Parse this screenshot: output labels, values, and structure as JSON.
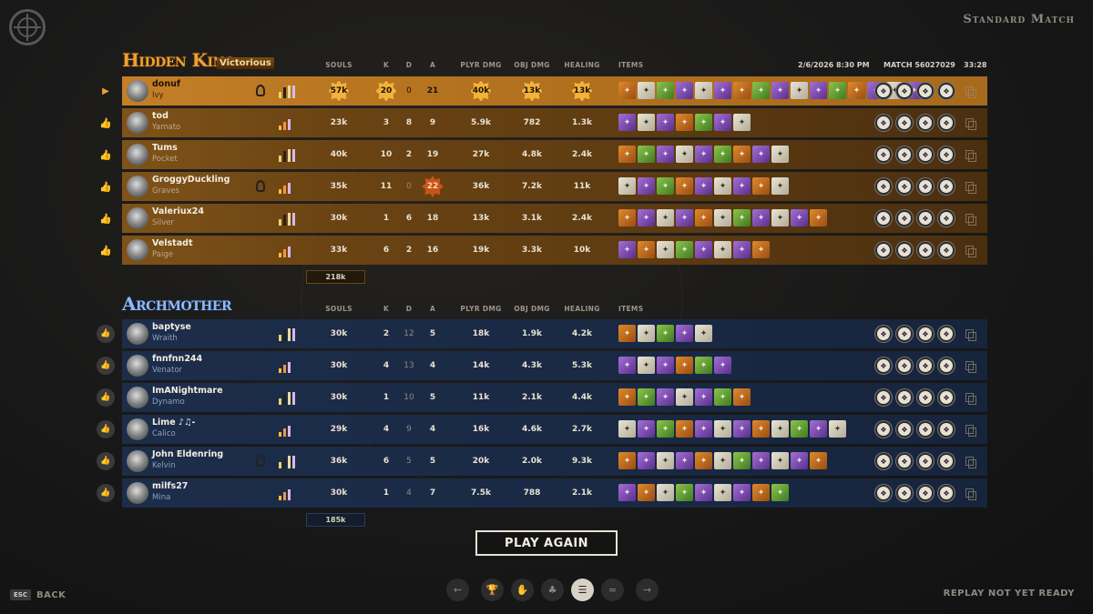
{
  "page": {
    "mode_title": "Standard Match",
    "match_date": "2/6/2026 8:30 PM",
    "match_id": "MATCH 56027029",
    "duration": "33:28",
    "play_again": "PLAY AGAIN",
    "esc_key": "ESC",
    "back_label": "BACK",
    "replay_status": "REPLAY NOT YET READY"
  },
  "columns": {
    "souls": "SOULS",
    "k": "K",
    "d": "D",
    "a": "A",
    "plyr_dmg": "PLYR DMG",
    "obj_dmg": "OBJ DMG",
    "healing": "HEALING",
    "items": "ITEMS"
  },
  "colors": {
    "amber": "#f0a030",
    "blue": "#8fb8f5",
    "badge": "#f2b33d"
  },
  "team1": {
    "name": "Hidden King",
    "result": "Victorious",
    "total_souls": "218k",
    "players": [
      {
        "name": "donuf",
        "hero": "Ivy",
        "souls": "57k",
        "k": "20",
        "d": "0",
        "a": "21",
        "pdmg": "40k",
        "odmg": "13k",
        "heal": "13k",
        "rank": true
      },
      {
        "name": "tod",
        "hero": "Yamato",
        "souls": "23k",
        "k": "3",
        "d": "8",
        "a": "9",
        "pdmg": "5.9k",
        "odmg": "782",
        "heal": "1.3k"
      },
      {
        "name": "Tums",
        "hero": "Pocket",
        "souls": "40k",
        "k": "10",
        "d": "2",
        "a": "19",
        "pdmg": "27k",
        "odmg": "4.8k",
        "heal": "2.4k"
      },
      {
        "name": "GroggyDuckling",
        "hero": "Graves",
        "souls": "35k",
        "k": "11",
        "d": "0",
        "a": "22",
        "pdmg": "36k",
        "odmg": "7.2k",
        "heal": "11k",
        "rank": true
      },
      {
        "name": "Valeriux24",
        "hero": "Silver",
        "souls": "30k",
        "k": "1",
        "d": "6",
        "a": "18",
        "pdmg": "13k",
        "odmg": "3.1k",
        "heal": "2.4k"
      },
      {
        "name": "Velstadt",
        "hero": "Paige",
        "souls": "33k",
        "k": "6",
        "d": "2",
        "a": "16",
        "pdmg": "19k",
        "odmg": "3.3k",
        "heal": "10k"
      }
    ]
  },
  "team2": {
    "name": "Archmother",
    "total_souls": "185k",
    "players": [
      {
        "name": "baptyse",
        "hero": "Wraith",
        "souls": "30k",
        "k": "2",
        "d": "12",
        "a": "5",
        "pdmg": "18k",
        "odmg": "1.9k",
        "heal": "4.2k"
      },
      {
        "name": "fnnfnn244",
        "hero": "Venator",
        "souls": "30k",
        "k": "4",
        "d": "13",
        "a": "4",
        "pdmg": "14k",
        "odmg": "4.3k",
        "heal": "5.3k"
      },
      {
        "name": "ImANightmare",
        "hero": "Dynamo",
        "souls": "30k",
        "k": "1",
        "d": "10",
        "a": "5",
        "pdmg": "11k",
        "odmg": "2.1k",
        "heal": "4.4k"
      },
      {
        "name": "Lime ♪♫-",
        "hero": "Calico",
        "souls": "29k",
        "k": "4",
        "d": "9",
        "a": "4",
        "pdmg": "16k",
        "odmg": "4.6k",
        "heal": "2.7k"
      },
      {
        "name": "John Eldenring",
        "hero": "Kelvin",
        "souls": "36k",
        "k": "6",
        "d": "5",
        "a": "5",
        "pdmg": "20k",
        "odmg": "2.0k",
        "heal": "9.3k",
        "rank": true
      },
      {
        "name": "milfs27",
        "hero": "Mina",
        "souls": "30k",
        "k": "1",
        "d": "4",
        "a": "7",
        "pdmg": "7.5k",
        "odmg": "788",
        "heal": "2.1k"
      }
    ]
  }
}
